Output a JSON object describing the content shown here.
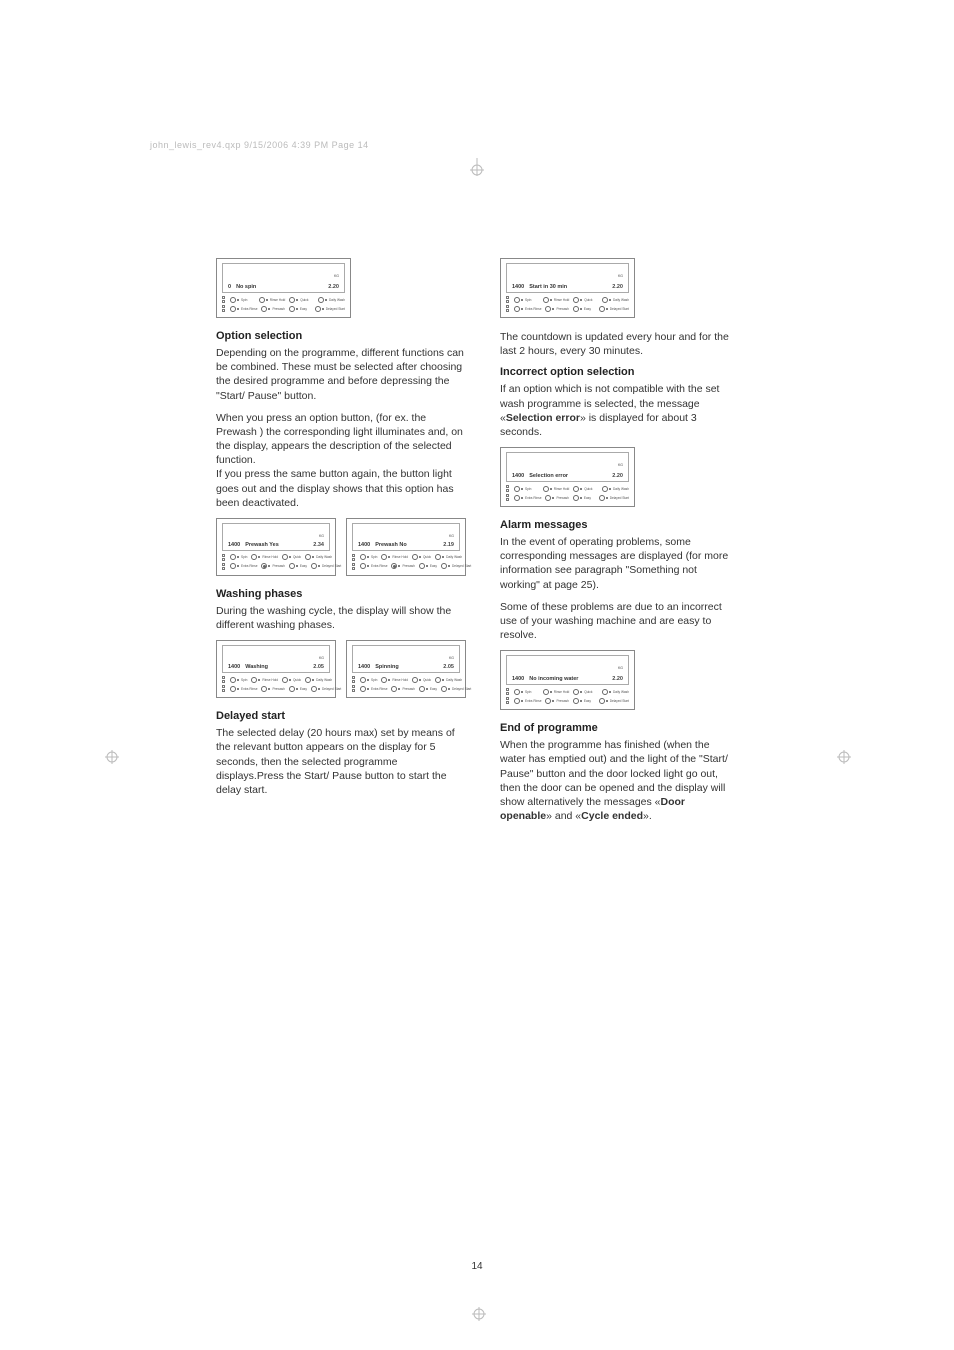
{
  "meta": {
    "header": "john_lewis_rev4.qxp   9/15/2006   4:39 PM   Page 14"
  },
  "page_number": "14",
  "left": {
    "h1": "Option selection",
    "p1": "Depending on the programme, different functions can be combined. These must be selected after choosing the desired programme and before depressing the \"Start/ Pause\" button.",
    "p2": "When you press an option button, (for ex. the Prewash ) the corresponding light illuminates and, on the display, appears the description of the selected function.",
    "p3": "If you press the same button again, the button light goes out and the display shows that this option has been deactivated.",
    "h2": "Washing phases",
    "p4": "During the washing cycle, the display will show the different washing phases.",
    "h3": "Delayed start",
    "p5": "The selected delay (20 hours max) set by means of the relevant button appears on the display for 5 seconds, then the selected programme displays.Press the Start/ Pause button to start the delay start."
  },
  "right": {
    "p1": "The countdown is updated every hour and for the last 2 hours, every 30 minutes.",
    "h1": "Incorrect option selection",
    "p2a": "If an option which is not compatible with the set wash programme is selected, the message «",
    "p2b": "Selection error",
    "p2c": "» is displayed for about 3 seconds.",
    "h2": "Alarm messages",
    "p3": "In the event of operating problems, some corresponding messages are displayed (for more information see paragraph \"Something not working\" at page 25).",
    "p4": "Some of these problems are due to an incorrect use of your washing machine and are easy to resolve.",
    "h3": "End of programme",
    "p5a": "When the programme has finished (when the water has emptied out) and the light of the \"Start/ Pause\" button and the door locked light go out, then the door can be opened and the display will show alternatively the messages «",
    "p5b": "Door openable",
    "p5c": "» and «",
    "p5d": "Cycle ended",
    "p5e": "»."
  },
  "panels": {
    "unit": "KG",
    "nospin": {
      "spin": "0",
      "msg": "No spin",
      "load": "2.20"
    },
    "prewash_yes": {
      "spin": "1400",
      "msg": "Prewash Yes",
      "load": "2.34"
    },
    "prewash_no": {
      "spin": "1400",
      "msg": "Prewash No",
      "load": "2.19"
    },
    "washing": {
      "spin": "1400",
      "msg": "Washing",
      "load": "2.05"
    },
    "spinning": {
      "spin": "1400",
      "msg": "Spinning",
      "load": "2.05"
    },
    "start30": {
      "spin": "1400",
      "msg": "Start in 30 min",
      "load": "2.20"
    },
    "selerr": {
      "spin": "1400",
      "msg": "Selection error",
      "load": "2.20"
    },
    "nowater": {
      "spin": "1400",
      "msg": "No incoming water",
      "load": "2.20"
    },
    "opts": {
      "r1": [
        "Spin",
        "Rinse Hold",
        "Quick",
        "Daily Wash"
      ],
      "r2": [
        "Extra Rinse",
        "Prewash",
        "Easy",
        "Delayed Start"
      ]
    }
  }
}
